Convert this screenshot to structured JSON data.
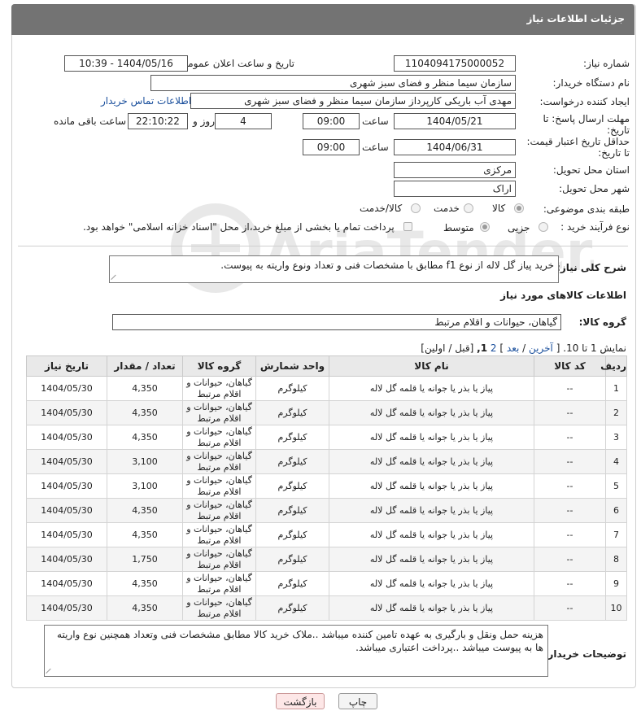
{
  "window_title": "جزئیات اطلاعات نیاز",
  "fields": {
    "need_number_label": "شماره نیاز:",
    "need_number": "1104094175000052",
    "announce_label": "تاریخ و ساعت اعلان عمومی:",
    "announce_value": "1404/05/16 - 10:39",
    "buyer_org_label": "نام دستگاه خریدار:",
    "buyer_org": "سازمان سیما منظر و فضای سبز شهری",
    "creator_label": "ایجاد کننده درخواست:",
    "creator": "مهدی آب باریکی کارپرداز سازمان سیما منظر و فضای سبز شهری",
    "contact_link": "اطلاعات تماس خریدار",
    "deadline_label": "مهلت ارسال پاسخ: تا تاریخ:",
    "deadline_date": "1404/05/21",
    "time_label": "ساعت",
    "deadline_time": "09:00",
    "days_value": "4",
    "days_label": "روز و",
    "remaining_time": "22:10:22",
    "remaining_label": "ساعت باقی مانده",
    "validity_label": "حداقل تاریخ اعتبار قیمت: تا تاریخ:",
    "validity_date": "1404/06/31",
    "validity_time": "09:00",
    "province_label": "استان محل تحویل:",
    "province": "مرکزی",
    "city_label": "شهر محل تحویل:",
    "city": "اراک",
    "category_label": "طبقه بندی موضوعی:",
    "category_options": [
      "کالا",
      "خدمت",
      "کالا/خدمت"
    ],
    "process_label": "نوع فرآیند خرید :",
    "process_options": [
      "جزیی",
      "متوسط"
    ],
    "payment_note": "پرداخت تمام یا بخشی از مبلغ خرید،از محل \"اسناد خزانه اسلامی\" خواهد بود."
  },
  "description": {
    "label": "شرح کلی نیاز:",
    "text": "خرید پیاز گل لاله از نوع f1 مطابق با مشخصات فنی و تعداد ونوع واریته به پیوست."
  },
  "items_section": {
    "title": "اطلاعات کالاهای مورد نیاز",
    "group_label": "گروه کالا:",
    "group_value": "گیاهان، حیوانات و اقلام مرتبط",
    "paging": {
      "text_show": "نمایش 1 تا 10.",
      "open": "[",
      "last": "آخرین",
      "slash": "/",
      "next": "بعد",
      "page2": "2",
      "page1": "1,",
      "close": "]",
      "prev_first": "[قبل / اولین]"
    },
    "columns": [
      "ردیف",
      "کد کالا",
      "نام کالا",
      "واحد شمارش",
      "گروه کالا",
      "تعداد / مقدار",
      "تاریخ نیاز"
    ],
    "rows": [
      {
        "row": "1",
        "code": "--",
        "name": "پیاز یا بذر یا جوانه یا قلمه گل لاله",
        "unit": "کیلوگرم",
        "group": "گیاهان، حیوانات و اقلام مرتبط",
        "qty": "4,350",
        "date": "1404/05/30"
      },
      {
        "row": "2",
        "code": "--",
        "name": "پیاز یا بذر یا جوانه یا قلمه گل لاله",
        "unit": "کیلوگرم",
        "group": "گیاهان، حیوانات و اقلام مرتبط",
        "qty": "4,350",
        "date": "1404/05/30"
      },
      {
        "row": "3",
        "code": "--",
        "name": "پیاز یا بذر یا جوانه یا قلمه گل لاله",
        "unit": "کیلوگرم",
        "group": "گیاهان، حیوانات و اقلام مرتبط",
        "qty": "4,350",
        "date": "1404/05/30"
      },
      {
        "row": "4",
        "code": "--",
        "name": "پیاز یا بذر یا جوانه یا قلمه گل لاله",
        "unit": "کیلوگرم",
        "group": "گیاهان، حیوانات و اقلام مرتبط",
        "qty": "3,100",
        "date": "1404/05/30"
      },
      {
        "row": "5",
        "code": "--",
        "name": "پیاز یا بذر یا جوانه یا قلمه گل لاله",
        "unit": "کیلوگرم",
        "group": "گیاهان، حیوانات و اقلام مرتبط",
        "qty": "3,100",
        "date": "1404/05/30"
      },
      {
        "row": "6",
        "code": "--",
        "name": "پیاز یا بذر یا جوانه یا قلمه گل لاله",
        "unit": "کیلوگرم",
        "group": "گیاهان، حیوانات و اقلام مرتبط",
        "qty": "4,350",
        "date": "1404/05/30"
      },
      {
        "row": "7",
        "code": "--",
        "name": "پیاز یا بذر یا جوانه یا قلمه گل لاله",
        "unit": "کیلوگرم",
        "group": "گیاهان، حیوانات و اقلام مرتبط",
        "qty": "4,350",
        "date": "1404/05/30"
      },
      {
        "row": "8",
        "code": "--",
        "name": "پیاز یا بذر یا جوانه یا قلمه گل لاله",
        "unit": "کیلوگرم",
        "group": "گیاهان، حیوانات و اقلام مرتبط",
        "qty": "1,750",
        "date": "1404/05/30"
      },
      {
        "row": "9",
        "code": "--",
        "name": "پیاز یا بذر یا جوانه یا قلمه گل لاله",
        "unit": "کیلوگرم",
        "group": "گیاهان، حیوانات و اقلام مرتبط",
        "qty": "4,350",
        "date": "1404/05/30"
      },
      {
        "row": "10",
        "code": "--",
        "name": "پیاز یا بذر یا جوانه یا قلمه گل لاله",
        "unit": "کیلوگرم",
        "group": "گیاهان، حیوانات و اقلام مرتبط",
        "qty": "4,350",
        "date": "1404/05/30"
      }
    ]
  },
  "buyer_notes": {
    "label": "توضیحات خریدار:",
    "text": "هزینه حمل ونقل و بارگیری به عهده تامین کننده میباشد ..ملاک خرید کالا مطابق مشخصات  فنی وتعداد همچنین نوع واریته ها به پیوست میباشد ..پرداخت اعتباری میباشد."
  },
  "buttons": {
    "print": "چاپ",
    "back": "بازگشت"
  },
  "watermark_text": "AriaTender.net",
  "colors": {
    "title_bar": "#737373",
    "link": "#1a4f9c",
    "back_button": "#fde7e7",
    "table_header": "#e9e9e9"
  }
}
